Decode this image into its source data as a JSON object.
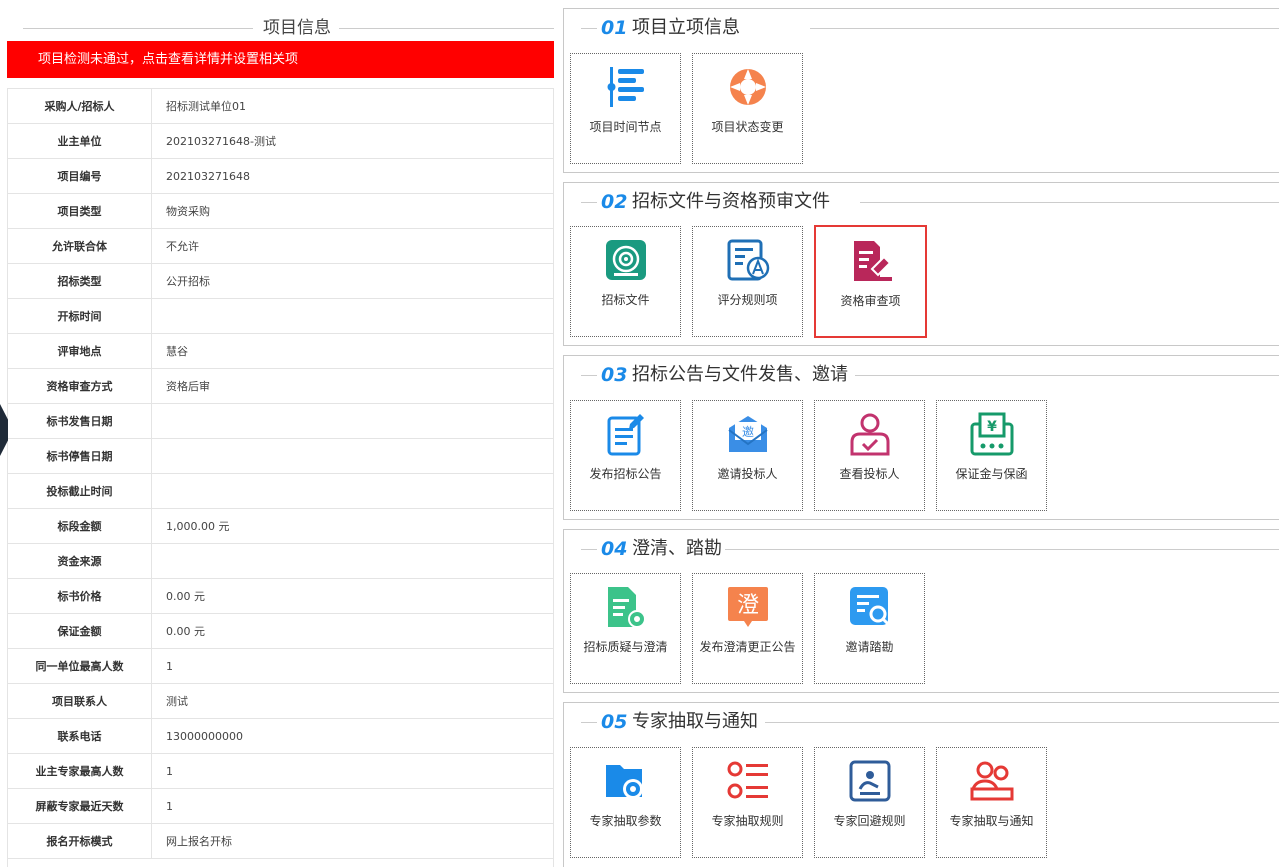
{
  "project_info": {
    "title": "项目信息",
    "alert": "项目检测未通过，点击查看详情并设置相关项",
    "rows": [
      {
        "key": "采购人/招标人",
        "value": "招标测试单位01"
      },
      {
        "key": "业主单位",
        "value": "202103271648-测试"
      },
      {
        "key": "项目编号",
        "value": "202103271648"
      },
      {
        "key": "项目类型",
        "value": "物资采购"
      },
      {
        "key": "允许联合体",
        "value": "不允许"
      },
      {
        "key": "招标类型",
        "value": "公开招标"
      },
      {
        "key": "开标时间",
        "value": ""
      },
      {
        "key": "评审地点",
        "value": "慧谷"
      },
      {
        "key": "资格审查方式",
        "value": "资格后审"
      },
      {
        "key": "标书发售日期",
        "value": ""
      },
      {
        "key": "标书停售日期",
        "value": ""
      },
      {
        "key": "投标截止时间",
        "value": ""
      },
      {
        "key": "标段金额",
        "value": "1,000.00 元"
      },
      {
        "key": "资金来源",
        "value": ""
      },
      {
        "key": "标书价格",
        "value": "0.00 元"
      },
      {
        "key": "保证金额",
        "value": "0.00 元"
      },
      {
        "key": "同一单位最高人数",
        "value": "1"
      },
      {
        "key": "项目联系人",
        "value": "测试"
      },
      {
        "key": "联系电话",
        "value": "13000000000"
      },
      {
        "key": "业主专家最高人数",
        "value": "1"
      },
      {
        "key": "屏蔽专家最近天数",
        "value": "1"
      },
      {
        "key": "报名开标模式",
        "value": "网上报名开标"
      }
    ]
  },
  "sections": [
    {
      "num": "01",
      "title": "项目立项信息",
      "tiles": [
        {
          "label": "项目时间节点",
          "icon": "timeline-icon",
          "color": "#1a8ae8"
        },
        {
          "label": "项目状态变更",
          "icon": "refresh-cycle-icon",
          "color": "#f5834d"
        }
      ]
    },
    {
      "num": "02",
      "title": "招标文件与资格预审文件",
      "tiles": [
        {
          "label": "招标文件",
          "icon": "target-document-icon",
          "color": "#1a9a80"
        },
        {
          "label": "评分规则项",
          "icon": "scoring-rules-icon",
          "color": "#1f6fb5"
        },
        {
          "label": "资格审查项",
          "icon": "qualification-review-icon",
          "color": "#b9275a",
          "selected": true
        }
      ]
    },
    {
      "num": "03",
      "title": "招标公告与文件发售、邀请",
      "tiles": [
        {
          "label": "发布招标公告",
          "icon": "publish-notice-icon",
          "color": "#1a8ae8"
        },
        {
          "label": "邀请投标人",
          "icon": "invite-envelope-icon",
          "color": "#3a8ee6",
          "glyph": "邀"
        },
        {
          "label": "查看投标人",
          "icon": "view-bidder-icon",
          "color": "#c2336e"
        },
        {
          "label": "保证金与保函",
          "icon": "deposit-guarantee-icon",
          "color": "#169a6a",
          "glyph": "¥"
        }
      ]
    },
    {
      "num": "04",
      "title": "澄清、踏勘",
      "tiles": [
        {
          "label": "招标质疑与澄清",
          "icon": "question-clarify-icon",
          "color": "#3cc38a"
        },
        {
          "label": "发布澄清更正公告",
          "icon": "clarify-notice-icon",
          "color": "#f5834d",
          "glyph": "澄"
        },
        {
          "label": "邀请踏勘",
          "icon": "site-survey-icon",
          "color": "#2d9af0"
        }
      ]
    },
    {
      "num": "05",
      "title": "专家抽取与通知",
      "tiles": [
        {
          "label": "专家抽取参数",
          "icon": "folder-settings-icon",
          "color": "#1a8ae8"
        },
        {
          "label": "专家抽取规则",
          "icon": "rule-list-icon",
          "color": "#e53935"
        },
        {
          "label": "专家回避规则",
          "icon": "avoid-rule-icon",
          "color": "#2f5c99"
        },
        {
          "label": "专家抽取与通知",
          "icon": "expert-group-icon",
          "color": "#e53935"
        }
      ]
    }
  ]
}
